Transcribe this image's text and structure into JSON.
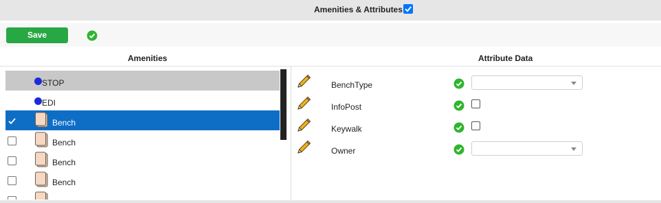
{
  "header": {
    "title": "Amenities & Attributes",
    "title_checkbox_checked": true
  },
  "toolbar": {
    "save_label": "Save",
    "status_icon": "check-circle-icon"
  },
  "amenities": {
    "heading": "Amenities",
    "items": [
      {
        "label": "STOP",
        "kind": "blue-dot",
        "state": "gray-selected"
      },
      {
        "label": "EDI",
        "kind": "blue-dot",
        "state": "normal"
      },
      {
        "label": "Bench",
        "kind": "document",
        "state": "blue-selected",
        "checked": true
      },
      {
        "label": "Bench",
        "kind": "document",
        "state": "normal",
        "checked": false
      },
      {
        "label": "Bench",
        "kind": "document",
        "state": "normal",
        "checked": false
      },
      {
        "label": "Bench",
        "kind": "document",
        "state": "normal",
        "checked": false
      }
    ]
  },
  "attributes": {
    "heading": "Attribute Data",
    "rows": [
      {
        "name": "BenchType",
        "control": "select",
        "value": ""
      },
      {
        "name": "InfoPost",
        "control": "checkbox",
        "checked": false
      },
      {
        "name": "Keywalk",
        "control": "checkbox",
        "checked": false
      },
      {
        "name": "Owner",
        "control": "select",
        "value": ""
      }
    ]
  },
  "colors": {
    "save": "#28a745",
    "selection": "#0e6ec6",
    "ok": "#2fb52f",
    "dot": "#1c2bd8"
  }
}
